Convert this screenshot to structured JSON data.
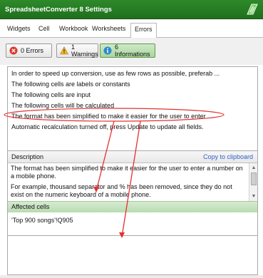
{
  "window": {
    "title": "SpreadsheetConverter 8 Settings",
    "logo_icon": "spreadsheetconverter-logo-icon"
  },
  "tabs": [
    {
      "label": "Widgets"
    },
    {
      "label": "Cell"
    },
    {
      "label": "Workbook"
    },
    {
      "label": "Worksheets"
    },
    {
      "label": "Errors",
      "active": true
    }
  ],
  "filters": {
    "errors": {
      "label": "0 Errors",
      "icon": "error-icon",
      "color": "#d93a2b"
    },
    "warnings": {
      "label": "1 Warnings",
      "icon": "warning-icon",
      "color": "#f0b428"
    },
    "informations": {
      "label": "6 Informations",
      "icon": "info-icon",
      "color": "#2d8ad0",
      "active": true
    }
  },
  "messages": [
    "In order to speed up conversion, use as few rows as possible, preferab ...",
    "The following cells are labels or constants",
    "The following cells are input",
    "The following cells will be calculated",
    "The format has been simplified to make it easier for the user to enter ...",
    "Automatic recalculation turned off, press Update to update all fields."
  ],
  "description": {
    "label": "Description",
    "copy_link": "Copy to clipboard",
    "para1": "The format has been simplified to make it easier for the user to enter a number on a mobile phone.",
    "para2": "For example, thousand separator and % has been removed, since they do not exist on the numeric keyboard of a mobile phone."
  },
  "affected": {
    "label": "Affected cells",
    "cells": "'Top 900 songs'!Q905"
  },
  "annotation_color": "#e53030"
}
